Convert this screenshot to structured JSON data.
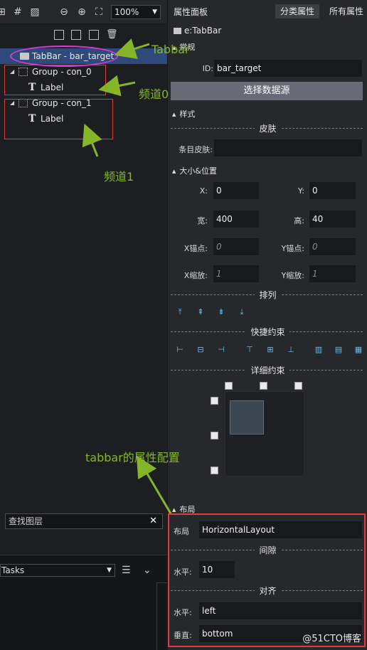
{
  "left_toolbar": {
    "zoom_value": "100%"
  },
  "layers": {
    "tabbar": "TabBar - bar_target",
    "group0": "Group - con_0",
    "group0_child": "Label",
    "group1": "Group - con_1",
    "group1_child": "Label"
  },
  "annotations": {
    "tabbar_note": "Tabbar",
    "channel0_note": "频道0",
    "channel1_note": "频道1",
    "config_note": "tabbar的属性配置"
  },
  "search": {
    "placeholder": "查找图层"
  },
  "tasks": {
    "select_value": "Tasks"
  },
  "panel": {
    "title": "属性面板",
    "tab_category": "分类属性",
    "tab_all": "所有属性",
    "component": "e:TabBar"
  },
  "general": {
    "section": "常规",
    "id_label": "ID:",
    "id_value": "bar_target",
    "select_data_source": "选择数据源"
  },
  "style": {
    "section": "样式",
    "skin_title": "皮肤",
    "item_skin_label": "条目皮肤:",
    "item_skin_value": ""
  },
  "size_position": {
    "section": "大小&位置",
    "x_label": "X:",
    "x_value": "0",
    "y_label": "Y:",
    "y_value": "0",
    "width_label": "宽:",
    "width_value": "400",
    "height_label": "高:",
    "height_value": "40",
    "anchor_x_label": "X锚点:",
    "anchor_x_value": "0",
    "anchor_y_label": "Y锚点:",
    "anchor_y_value": "0",
    "scale_x_label": "X缩放:",
    "scale_x_value": "1",
    "scale_y_label": "Y缩放:",
    "scale_y_value": "1",
    "arrange_title": "排列",
    "quick_constraint_title": "快捷约束",
    "detail_constraint_title": "详细约束"
  },
  "layout": {
    "section": "布局",
    "layout_label": "布局",
    "layout_value": "HorizontalLayout",
    "gap_title": "间隙",
    "horizontal_gap_label": "水平:",
    "horizontal_gap_value": "10",
    "align_title": "对齐",
    "horizontal_align_label": "水平:",
    "horizontal_align_value": "left",
    "vertical_align_label": "垂直:",
    "vertical_align_value": "bottom"
  },
  "watermark": "@51CTO博客",
  "colors": {
    "accent": "#2f4a7a",
    "annotation_green": "#86b52a",
    "annotation_red": "#e23b3b",
    "annotation_magenta": "#d63bd6",
    "icon_blue": "#67b9e6"
  }
}
